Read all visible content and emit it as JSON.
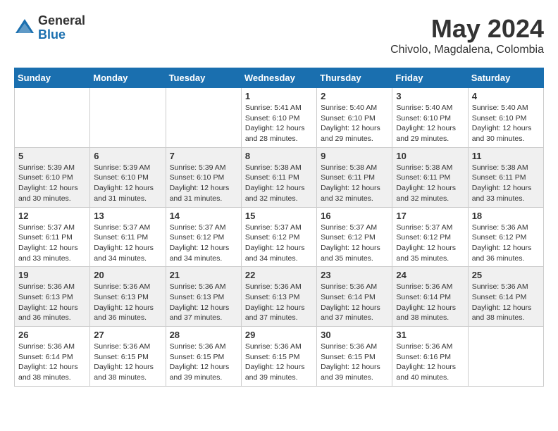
{
  "header": {
    "logo_general": "General",
    "logo_blue": "Blue",
    "month_title": "May 2024",
    "location": "Chivolo, Magdalena, Colombia"
  },
  "calendar": {
    "days_of_week": [
      "Sunday",
      "Monday",
      "Tuesday",
      "Wednesday",
      "Thursday",
      "Friday",
      "Saturday"
    ],
    "weeks": [
      [
        {
          "day": "",
          "info": ""
        },
        {
          "day": "",
          "info": ""
        },
        {
          "day": "",
          "info": ""
        },
        {
          "day": "1",
          "info": "Sunrise: 5:41 AM\nSunset: 6:10 PM\nDaylight: 12 hours\nand 28 minutes."
        },
        {
          "day": "2",
          "info": "Sunrise: 5:40 AM\nSunset: 6:10 PM\nDaylight: 12 hours\nand 29 minutes."
        },
        {
          "day": "3",
          "info": "Sunrise: 5:40 AM\nSunset: 6:10 PM\nDaylight: 12 hours\nand 29 minutes."
        },
        {
          "day": "4",
          "info": "Sunrise: 5:40 AM\nSunset: 6:10 PM\nDaylight: 12 hours\nand 30 minutes."
        }
      ],
      [
        {
          "day": "5",
          "info": "Sunrise: 5:39 AM\nSunset: 6:10 PM\nDaylight: 12 hours\nand 30 minutes."
        },
        {
          "day": "6",
          "info": "Sunrise: 5:39 AM\nSunset: 6:10 PM\nDaylight: 12 hours\nand 31 minutes."
        },
        {
          "day": "7",
          "info": "Sunrise: 5:39 AM\nSunset: 6:10 PM\nDaylight: 12 hours\nand 31 minutes."
        },
        {
          "day": "8",
          "info": "Sunrise: 5:38 AM\nSunset: 6:11 PM\nDaylight: 12 hours\nand 32 minutes."
        },
        {
          "day": "9",
          "info": "Sunrise: 5:38 AM\nSunset: 6:11 PM\nDaylight: 12 hours\nand 32 minutes."
        },
        {
          "day": "10",
          "info": "Sunrise: 5:38 AM\nSunset: 6:11 PM\nDaylight: 12 hours\nand 32 minutes."
        },
        {
          "day": "11",
          "info": "Sunrise: 5:38 AM\nSunset: 6:11 PM\nDaylight: 12 hours\nand 33 minutes."
        }
      ],
      [
        {
          "day": "12",
          "info": "Sunrise: 5:37 AM\nSunset: 6:11 PM\nDaylight: 12 hours\nand 33 minutes."
        },
        {
          "day": "13",
          "info": "Sunrise: 5:37 AM\nSunset: 6:11 PM\nDaylight: 12 hours\nand 34 minutes."
        },
        {
          "day": "14",
          "info": "Sunrise: 5:37 AM\nSunset: 6:12 PM\nDaylight: 12 hours\nand 34 minutes."
        },
        {
          "day": "15",
          "info": "Sunrise: 5:37 AM\nSunset: 6:12 PM\nDaylight: 12 hours\nand 34 minutes."
        },
        {
          "day": "16",
          "info": "Sunrise: 5:37 AM\nSunset: 6:12 PM\nDaylight: 12 hours\nand 35 minutes."
        },
        {
          "day": "17",
          "info": "Sunrise: 5:37 AM\nSunset: 6:12 PM\nDaylight: 12 hours\nand 35 minutes."
        },
        {
          "day": "18",
          "info": "Sunrise: 5:36 AM\nSunset: 6:12 PM\nDaylight: 12 hours\nand 36 minutes."
        }
      ],
      [
        {
          "day": "19",
          "info": "Sunrise: 5:36 AM\nSunset: 6:13 PM\nDaylight: 12 hours\nand 36 minutes."
        },
        {
          "day": "20",
          "info": "Sunrise: 5:36 AM\nSunset: 6:13 PM\nDaylight: 12 hours\nand 36 minutes."
        },
        {
          "day": "21",
          "info": "Sunrise: 5:36 AM\nSunset: 6:13 PM\nDaylight: 12 hours\nand 37 minutes."
        },
        {
          "day": "22",
          "info": "Sunrise: 5:36 AM\nSunset: 6:13 PM\nDaylight: 12 hours\nand 37 minutes."
        },
        {
          "day": "23",
          "info": "Sunrise: 5:36 AM\nSunset: 6:14 PM\nDaylight: 12 hours\nand 37 minutes."
        },
        {
          "day": "24",
          "info": "Sunrise: 5:36 AM\nSunset: 6:14 PM\nDaylight: 12 hours\nand 38 minutes."
        },
        {
          "day": "25",
          "info": "Sunrise: 5:36 AM\nSunset: 6:14 PM\nDaylight: 12 hours\nand 38 minutes."
        }
      ],
      [
        {
          "day": "26",
          "info": "Sunrise: 5:36 AM\nSunset: 6:14 PM\nDaylight: 12 hours\nand 38 minutes."
        },
        {
          "day": "27",
          "info": "Sunrise: 5:36 AM\nSunset: 6:15 PM\nDaylight: 12 hours\nand 38 minutes."
        },
        {
          "day": "28",
          "info": "Sunrise: 5:36 AM\nSunset: 6:15 PM\nDaylight: 12 hours\nand 39 minutes."
        },
        {
          "day": "29",
          "info": "Sunrise: 5:36 AM\nSunset: 6:15 PM\nDaylight: 12 hours\nand 39 minutes."
        },
        {
          "day": "30",
          "info": "Sunrise: 5:36 AM\nSunset: 6:15 PM\nDaylight: 12 hours\nand 39 minutes."
        },
        {
          "day": "31",
          "info": "Sunrise: 5:36 AM\nSunset: 6:16 PM\nDaylight: 12 hours\nand 40 minutes."
        },
        {
          "day": "",
          "info": ""
        }
      ]
    ]
  }
}
